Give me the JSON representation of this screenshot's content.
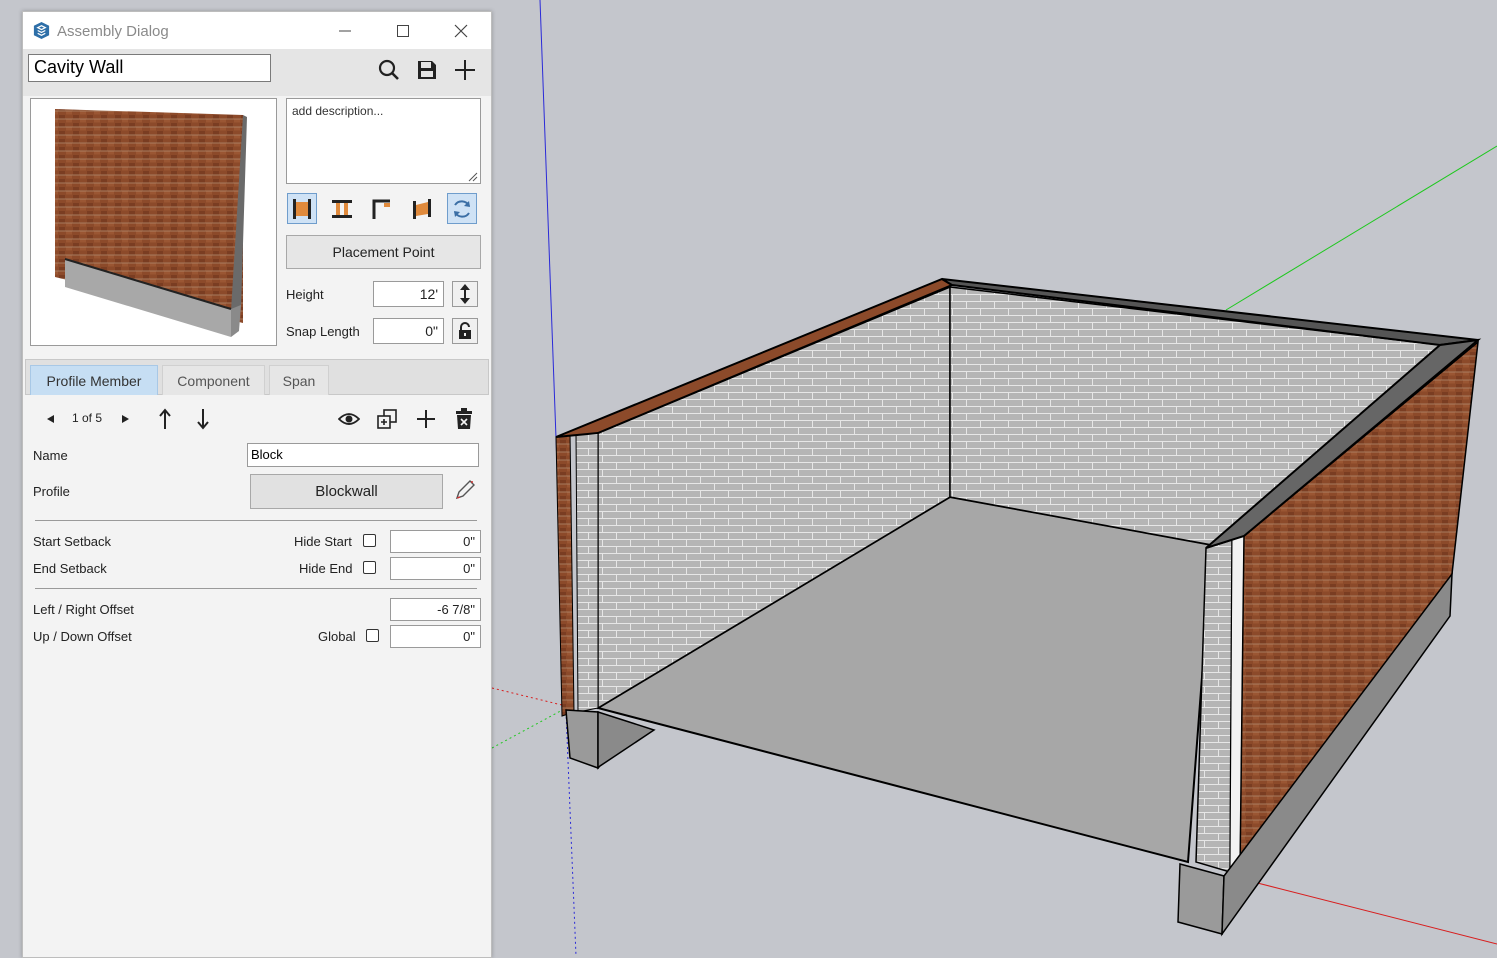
{
  "window": {
    "title": "Assembly Dialog"
  },
  "toolbar": {
    "assembly_name": "Cavity Wall"
  },
  "description": {
    "text": "add description..."
  },
  "placement": {
    "button_label": "Placement Point"
  },
  "height": {
    "label": "Height",
    "value": "12'"
  },
  "snap_length": {
    "label": "Snap Length",
    "value": "0\""
  },
  "tabs": [
    {
      "label": "Profile Member",
      "active": true
    },
    {
      "label": "Component",
      "active": false
    },
    {
      "label": "Span",
      "active": false
    }
  ],
  "member_nav": {
    "counter": "1 of 5"
  },
  "member": {
    "name_label": "Name",
    "name_value": "Block",
    "profile_label": "Profile",
    "profile_value": "Blockwall"
  },
  "setbacks": {
    "start_label": "Start Setback",
    "hide_start_label": "Hide Start",
    "start_value": "0\"",
    "end_label": "End Setback",
    "hide_end_label": "Hide End",
    "end_value": "0\""
  },
  "offsets": {
    "left_right_label": "Left / Right Offset",
    "left_right_value": "-6 7/8\"",
    "up_down_label": "Up / Down Offset",
    "global_label": "Global",
    "up_down_value": "0\""
  },
  "colors": {
    "viewport_bg": "#c4c6cc",
    "axis_red": "#d81e1e",
    "axis_green": "#1ec81e",
    "axis_blue": "#2a2ad8",
    "brick": "#8c4a2a",
    "block": "#b8b8b8",
    "floor": "#a7a7a7",
    "active_tab": "#c6def3",
    "accent_blue": "#3c6fa5"
  },
  "icons": [
    "sketchup-logo-icon",
    "search-icon",
    "save-icon",
    "plus-icon",
    "eye-icon",
    "duplicate-icon",
    "trash-icon",
    "arrow-up-icon",
    "arrow-down-icon",
    "triangle-left-icon",
    "triangle-right-icon",
    "refresh-icon",
    "lock-icon",
    "pencil-icon",
    "vertical-arrows-icon"
  ]
}
